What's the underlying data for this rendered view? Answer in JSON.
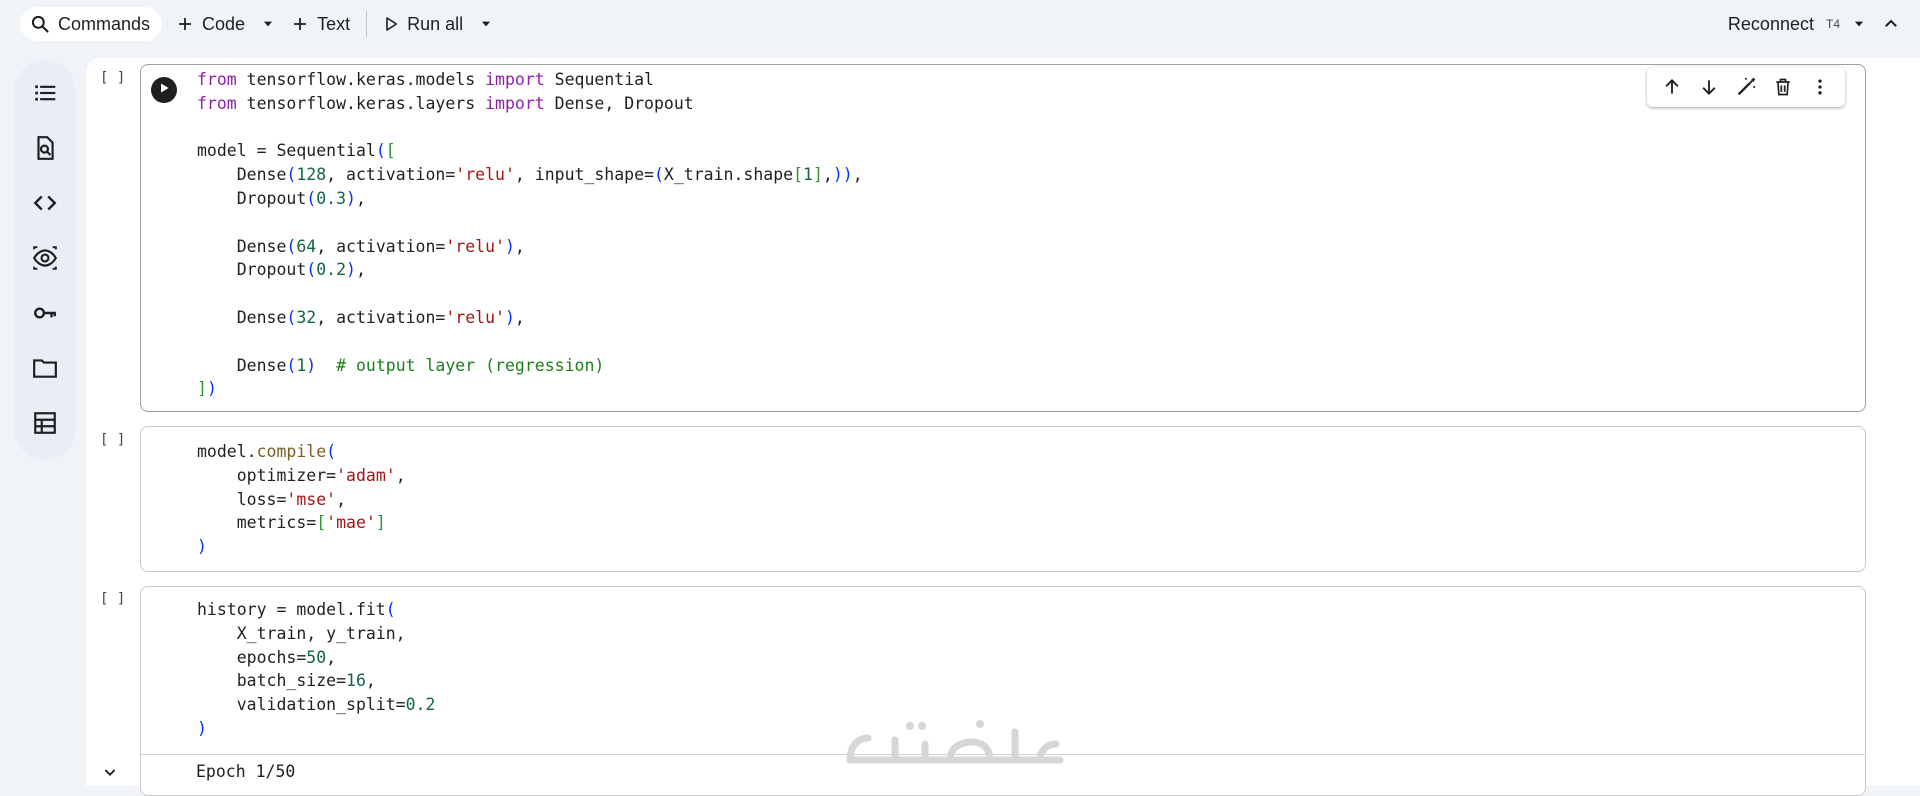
{
  "toolbar": {
    "commands_label": "Commands",
    "code_label": "Code",
    "text_label": "Text",
    "run_all_label": "Run all",
    "reconnect_label": "Reconnect",
    "gpu_label": "T4"
  },
  "cells": [
    {
      "gutter": "[ ]"
    },
    {
      "gutter": "[ ]"
    },
    {
      "gutter": "[ ]"
    }
  ],
  "output": {
    "first_line": "Epoch 1/50"
  },
  "watermark": {
    "text": "خمسات"
  },
  "icons": {
    "rail": [
      "table-of-contents-icon",
      "find-replace-icon",
      "code-snippets-icon",
      "variables-icon",
      "secrets-key-icon",
      "files-folder-icon",
      "data-table-icon"
    ],
    "cell_tools": [
      "move-up-icon",
      "move-down-icon",
      "edit-wand-icon",
      "delete-icon",
      "more-vert-icon"
    ]
  },
  "colors": {
    "keyword": "#8f1fa8",
    "string": "#a31515",
    "number": "#116644",
    "comment": "#1d7f1d",
    "bracket": "#0431fa"
  }
}
